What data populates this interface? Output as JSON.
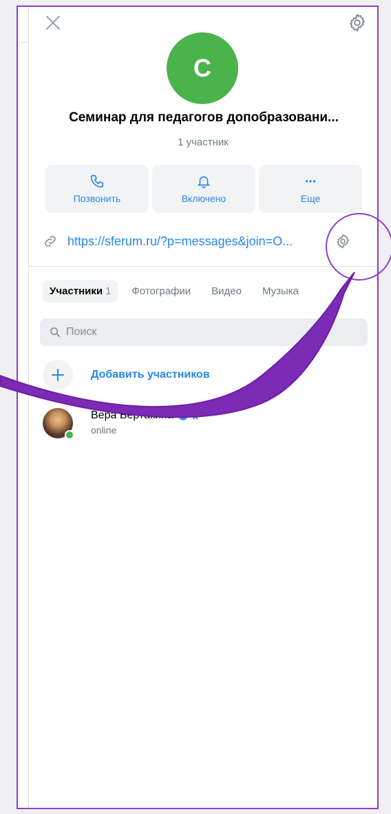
{
  "chat": {
    "avatar_letter": "С",
    "title": "Семинар для педагогов допобразовани...",
    "members_count": "1 участник"
  },
  "actions": [
    {
      "label": "Позвонить",
      "icon": "phone-icon"
    },
    {
      "label": "Включено",
      "icon": "bell-icon"
    },
    {
      "label": "Еще",
      "icon": "more-icon"
    }
  ],
  "invite_link": "https://sferum.ru/?p=messages&join=O...",
  "tabs": [
    {
      "label": "Участники",
      "count": "1"
    },
    {
      "label": "Фотографии"
    },
    {
      "label": "Видео"
    },
    {
      "label": "Музыка"
    }
  ],
  "search": {
    "placeholder": "Поиск"
  },
  "add_members": {
    "label": "Добавить участников"
  },
  "members": [
    {
      "name": "Вера Вертакина",
      "status": "online"
    }
  ],
  "colors": {
    "accent": "#2688eb",
    "online": "#4bb34b",
    "highlight": "#7b2bb5"
  }
}
